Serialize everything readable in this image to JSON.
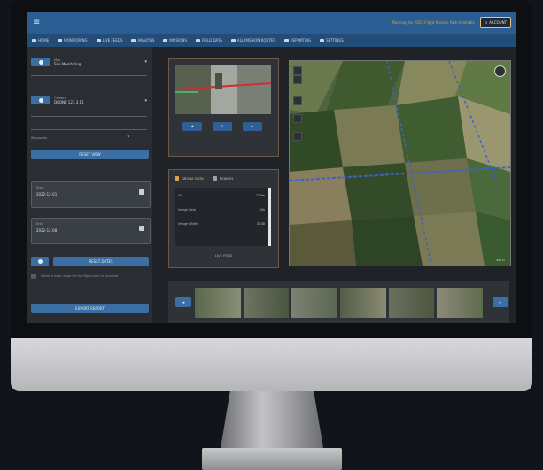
{
  "topbar": {
    "menu_icon": "menu-icon",
    "promo": "Planning for 2023 Flight Mission Path Available",
    "account": "ACCOUNT"
  },
  "nav": [
    {
      "label": "HOME"
    },
    {
      "label": "MONITORING"
    },
    {
      "label": "LIVE FEEDS"
    },
    {
      "label": "ANALYSIS"
    },
    {
      "label": "MISSIONS"
    },
    {
      "label": "FIELD DATA"
    },
    {
      "label": "ALL MISSION ROUTES"
    },
    {
      "label": "REPORTING"
    },
    {
      "label": "SETTINGS"
    }
  ],
  "left": {
    "mission": {
      "label": "Map",
      "value": "Site Monitoring"
    },
    "camera": {
      "label": "Camera",
      "value": "DRONE 123.3.11"
    },
    "dropdown_label": "Waypoints",
    "reset_view": "RESET VIEW",
    "start": {
      "label": "Start",
      "value": "2022-12-01"
    },
    "end": {
      "label": "End",
      "value": "2022-12-08"
    },
    "reset_dates": "RESET DATES",
    "note": "Select a date range for the flight path to visualize",
    "export": "EXPORT REPORT"
  },
  "data_panel": {
    "tab1": "DRONE DATA",
    "tab2": "SEARCH",
    "rows": [
      {
        "k": "Alt",
        "v": "120m"
      },
      {
        "k": "Image Rate",
        "v": "2/s"
      },
      {
        "k": "Image Width",
        "v": "3200"
      }
    ],
    "footer": "LIVE FEED"
  },
  "map": {
    "scale": "500 m"
  },
  "colors": {
    "accent": "#3b6ea3",
    "topbar": "#2a5e93",
    "panel_border": "#6b5a46",
    "warning": "#d8a34a"
  }
}
